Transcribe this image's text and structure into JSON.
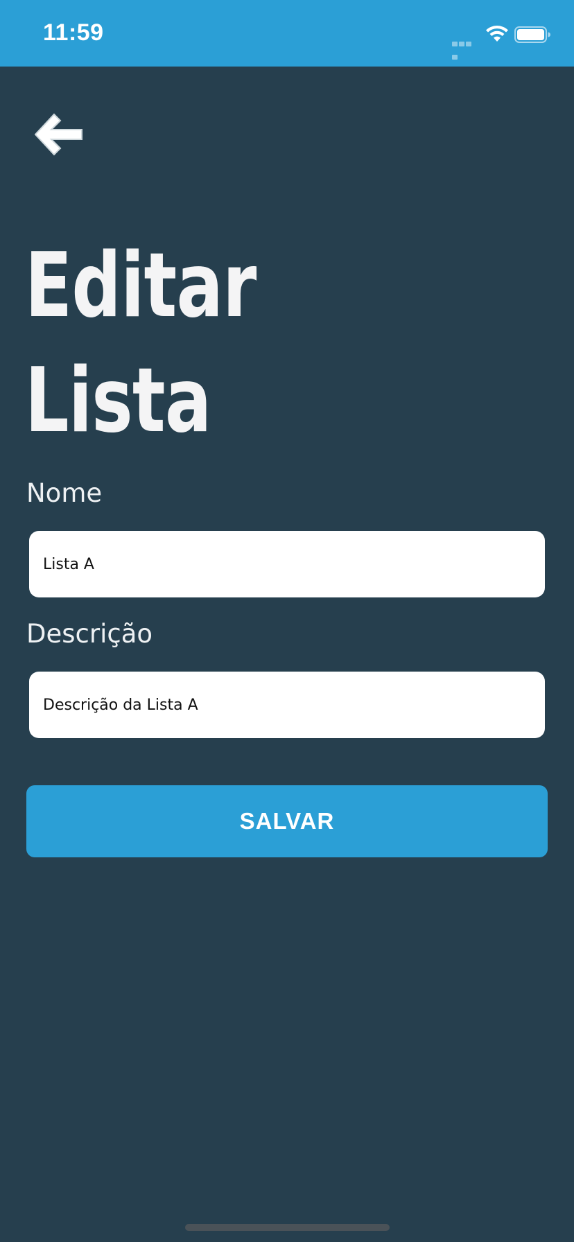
{
  "status_bar": {
    "time": "11:59",
    "background_color": "#2b9fd6",
    "icons": [
      "cellular-signal-icon",
      "wifi-icon",
      "battery-icon"
    ]
  },
  "navigation": {
    "back_icon": "arrow-left-icon"
  },
  "header": {
    "title_line1": "Editar",
    "title_line2": "Lista"
  },
  "form": {
    "nome": {
      "label": "Nome",
      "value": "Lista A"
    },
    "descricao": {
      "label": "Descrição",
      "value": "Descrição da Lista A"
    },
    "save_label": "SALVAR"
  },
  "colors": {
    "background": "#263f4e",
    "accent": "#2b9fd6",
    "title_text": "#f4f4f5",
    "input_background": "#ffffff"
  }
}
